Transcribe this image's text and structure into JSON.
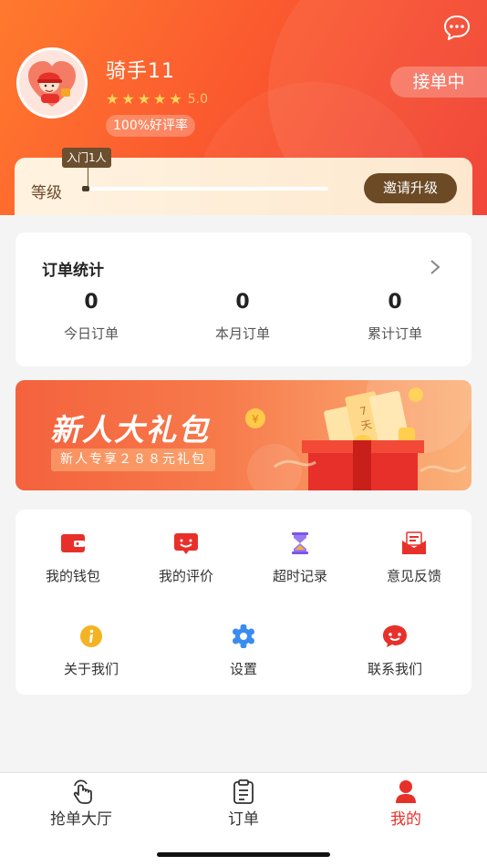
{
  "header": {
    "rider_name": "骑手11",
    "rating": "5.0",
    "stars_filled": 5,
    "good_rate": "100%好评率",
    "status": "接单中"
  },
  "level": {
    "label": "等级",
    "tooltip": "入门1人",
    "progress": 0.0,
    "invite_label": "邀请升级"
  },
  "order_stats": {
    "title": "订单统计",
    "items": [
      {
        "value": "0",
        "label": "今日订单"
      },
      {
        "value": "0",
        "label": "本月订单"
      },
      {
        "value": "0",
        "label": "累计订单"
      }
    ]
  },
  "banner": {
    "title": "新人大礼包",
    "subtitle": "新人专享２８８元礼包",
    "ticket_text_1": "7",
    "ticket_text_2": "天",
    "coin_text": "¥"
  },
  "menu": {
    "items": [
      {
        "label": "我的钱包",
        "icon": "wallet-icon",
        "color": "#e8302a"
      },
      {
        "label": "我的评价",
        "icon": "review-icon",
        "color": "#e8302a"
      },
      {
        "label": "超时记录",
        "icon": "hourglass-icon",
        "color": "#7b55e8"
      },
      {
        "label": "意见反馈",
        "icon": "feedback-mail-icon",
        "color": "#e8302a"
      },
      {
        "label": "关于我们",
        "icon": "info-icon",
        "color": "#f5b324"
      },
      {
        "label": "设置",
        "icon": "gear-icon",
        "color": "#3a8cf0"
      },
      {
        "label": "联系我们",
        "icon": "chat-icon",
        "color": "#e8302a"
      }
    ]
  },
  "tabbar": {
    "tabs": [
      {
        "label": "抢单大厅",
        "icon": "tap-hand-icon"
      },
      {
        "label": "订单",
        "icon": "clipboard-icon"
      },
      {
        "label": "我的",
        "icon": "profile-icon"
      }
    ],
    "active_index": 2
  },
  "colors": {
    "brand": "#f0392c",
    "accent": "#ff7a2e",
    "active_tab": "#e8302a",
    "invite_button": "#6b4a25"
  }
}
